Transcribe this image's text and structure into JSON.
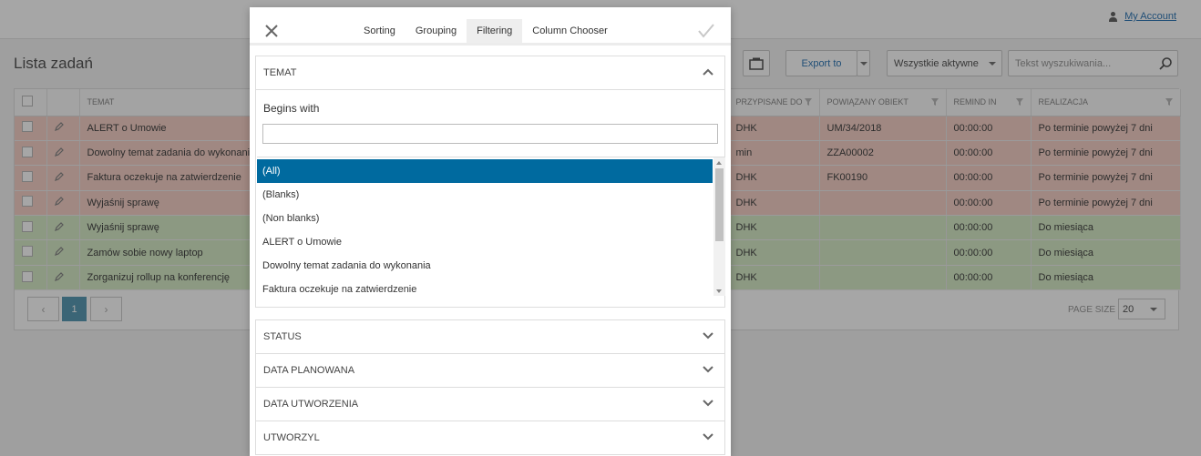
{
  "header": {
    "account_label": "My Account"
  },
  "page": {
    "title": "Lista zadań",
    "export_label": "Export to",
    "filter_select": "Wszystkie aktywne",
    "search_placeholder": "Tekst wyszukiwania..."
  },
  "grid": {
    "columns": [
      "TEMAT",
      "PRZYPISANE DO",
      "POWIĄZANY OBIEKT",
      "REMIND IN",
      "REALIZACJA"
    ],
    "rows": [
      {
        "temat": "ALERT o Umowie",
        "assigned": "DHK",
        "obiekt": "UM/34/2018",
        "remind": "00:00:00",
        "realizacja": "Po terminie powyżej 7 dni",
        "tone": "red"
      },
      {
        "temat": "Dowolny temat zadania do wykonania",
        "assigned": "min",
        "obiekt": "ZZA00002",
        "remind": "00:00:00",
        "realizacja": "Po terminie powyżej 7 dni",
        "tone": "red"
      },
      {
        "temat": "Faktura oczekuje na zatwierdzenie",
        "assigned": "DHK",
        "obiekt": "FK00190",
        "remind": "00:00:00",
        "realizacja": "Po terminie powyżej 7 dni",
        "tone": "red"
      },
      {
        "temat": "Wyjaśnij sprawę",
        "assigned": "DHK",
        "obiekt": "",
        "remind": "00:00:00",
        "realizacja": "Po terminie powyżej 7 dni",
        "tone": "red"
      },
      {
        "temat": "Wyjaśnij sprawę",
        "assigned": "DHK",
        "obiekt": "",
        "remind": "00:00:00",
        "realizacja": "Do miesiąca",
        "tone": "green"
      },
      {
        "temat": "Zamów sobie nowy laptop",
        "assigned": "DHK",
        "obiekt": "",
        "remind": "00:00:00",
        "realizacja": "Do miesiąca",
        "tone": "green"
      },
      {
        "temat": "Zorganizuj rollup na konferencję",
        "assigned": "DHK",
        "obiekt": "",
        "remind": "00:00:00",
        "realizacja": "Do miesiąca",
        "tone": "green"
      }
    ]
  },
  "pager": {
    "current_page": "1",
    "page_size_label": "PAGE SIZE",
    "page_size": "20"
  },
  "dialog": {
    "tabs": [
      "Sorting",
      "Grouping",
      "Filtering",
      "Column Chooser"
    ],
    "active_tab": "Filtering",
    "temat_section": {
      "label": "TEMAT",
      "begins_with_label": "Begins with",
      "begins_with_value": "",
      "options": [
        "(All)",
        "(Blanks)",
        "(Non blanks)",
        "ALERT o Umowie",
        "Dowolny temat zadania do wykonania",
        "Faktura oczekuje na zatwierdzenie"
      ],
      "selected": "(All)"
    },
    "collapsed_sections": [
      "STATUS",
      "DATA PLANOWANA",
      "DATA UTWORZENIA",
      "UTWORZYL"
    ]
  },
  "colors": {
    "selected_option": "#006a9f",
    "overdue_row": "#f6d2c8",
    "ok_row": "#d8ecc8",
    "active_page": "#5b9bb5"
  }
}
